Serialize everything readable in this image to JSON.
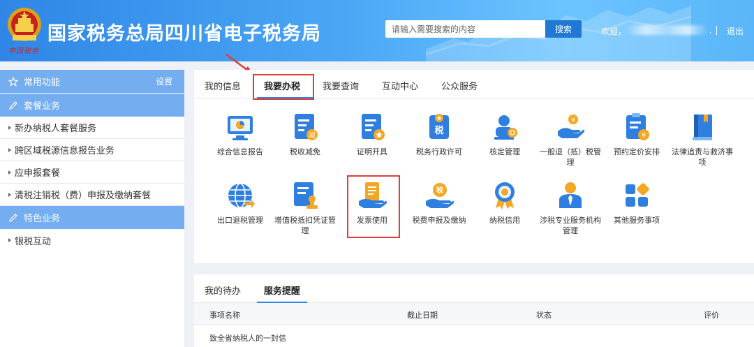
{
  "header": {
    "title": "国家税务总局四川省电子税务局",
    "seal_text": "中国税务",
    "search_placeholder": "请输入需要搜索的内容",
    "search_button": "搜索",
    "welcome": "欢迎，",
    "dot": ".",
    "logout": "退出"
  },
  "sidebar": {
    "common": {
      "label": "常用功能",
      "settings": "设置"
    },
    "package": {
      "label": "套餐业务"
    },
    "package_items": [
      "新办纳税人套餐服务",
      "跨区域税源信息报告业务",
      "应申报套餐",
      "清税注销税（费）申报及缴纳套餐"
    ],
    "special": {
      "label": "特色业务"
    },
    "special_items": [
      "银税互动"
    ]
  },
  "tabs": [
    "我的信息",
    "我要办税",
    "我要查询",
    "互动中心",
    "公众服务"
  ],
  "tiles_row1": [
    "综合信息报告",
    "税收减免",
    "证明开具",
    "税务行政许可",
    "核定管理",
    "一般退（抵）税管理",
    "预约定价安排",
    "法律追责与救济事项"
  ],
  "tiles_row2": [
    "出口退税管理",
    "增值税抵扣凭证管理",
    "发票使用",
    "税费申报及缴纳",
    "纳税信用",
    "涉税专业服务机构管理",
    "其他服务事项"
  ],
  "icon_text": {
    "reduce": "减",
    "tax": "税",
    "currency": "¥",
    "pay": "税"
  },
  "bottom_tabs": [
    "我的待办",
    "服务提醒"
  ],
  "table": {
    "headers": [
      "事项名称",
      "截止日期",
      "状态",
      "评价"
    ],
    "rows": [
      "致全省纳税人的一封信"
    ]
  },
  "colors": {
    "header_blue": "#2f86e6",
    "sidebar_head": "#74aef0",
    "highlight_red": "#e13b3b",
    "icon_blue": "#2f7fe0",
    "icon_orange": "#f5a623"
  }
}
